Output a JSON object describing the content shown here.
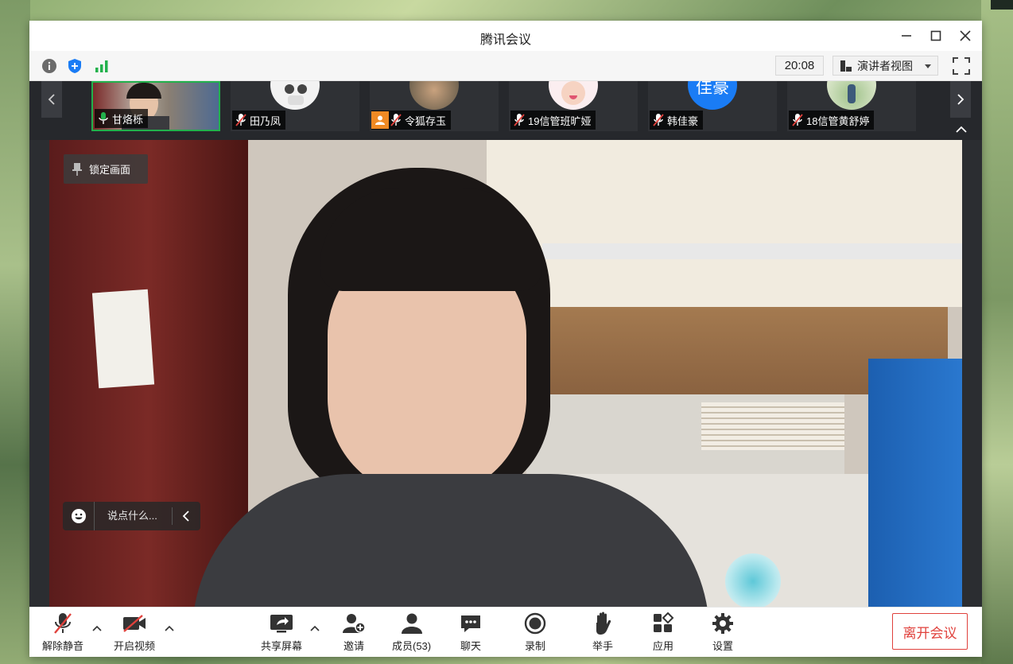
{
  "window": {
    "title": "腾讯会议"
  },
  "toolbar": {
    "time": "20:08",
    "view_label": "演讲者视图",
    "icons": [
      "info-icon",
      "shield-icon",
      "signal-icon",
      "fullscreen-icon"
    ]
  },
  "participants": [
    {
      "name": "甘烙栎",
      "mic": "on",
      "active": true,
      "avatar": "video-thumbnail"
    },
    {
      "name": "田乃凤",
      "mic": "muted",
      "active": false,
      "avatar": "cartoon-avatar"
    },
    {
      "name": "令狐存玉",
      "mic": "muted",
      "active": false,
      "avatar": "photo-avatar",
      "host": true
    },
    {
      "name": "19信管班旷娅",
      "mic": "muted",
      "active": false,
      "avatar": "cartoon-avatar"
    },
    {
      "name": "韩佳豪",
      "mic": "muted",
      "active": false,
      "avatar": "text-avatar",
      "avatar_text": "佳豪"
    },
    {
      "name": "18信管黄舒婷",
      "mic": "muted",
      "active": false,
      "avatar": "photo-avatar"
    }
  ],
  "stage": {
    "lock_label": "锁定画面",
    "chat_placeholder": "说点什么..."
  },
  "bottombar": {
    "unmute": "解除静音",
    "start_video": "开启视频",
    "share_screen": "共享屏幕",
    "invite": "邀请",
    "members": "成员(53)",
    "chat": "聊天",
    "record": "录制",
    "raise_hand": "举手",
    "apps": "应用",
    "settings": "设置",
    "leave": "离开会议"
  },
  "colors": {
    "active_border": "#22b14c",
    "leave_red": "#e0413c",
    "strip_bg": "#26282c",
    "accent_blue": "#1a7cf5",
    "host_badge": "#f08a24"
  }
}
